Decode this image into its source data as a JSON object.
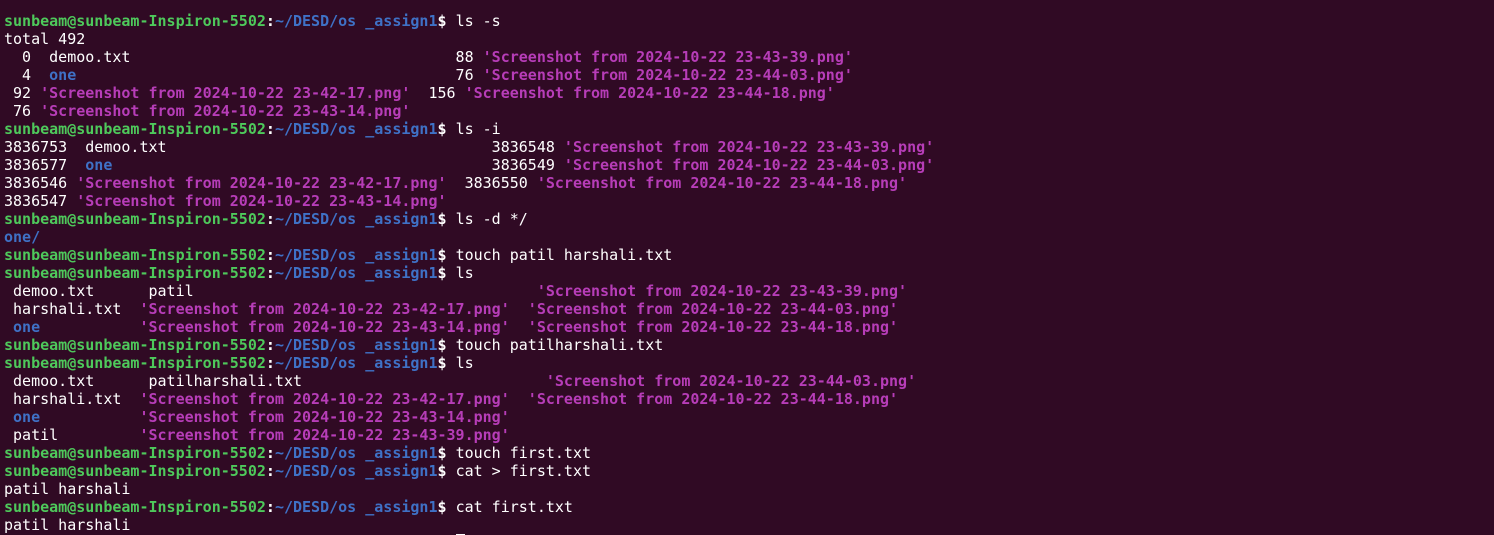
{
  "terminal": {
    "prompt": {
      "user_host": "sunbeam@sunbeam-Inspiron-5502",
      "colon": ":",
      "path": "~/DESD/os _assign1",
      "dollar": "$ "
    },
    "colors": {
      "background": "#300a24",
      "text": "#ffffff",
      "prompt_user": "#4ec95b",
      "prompt_path": "#3f71c6",
      "directory": "#3f71c6",
      "image_file": "#b73db8"
    },
    "lines": [
      {
        "kind": "out",
        "segments": [
          {
            "t": "",
            "c": "plain"
          }
        ]
      },
      {
        "kind": "cmd",
        "command": "ls -s"
      },
      {
        "kind": "out",
        "segments": [
          {
            "t": "total 492",
            "c": "plain"
          }
        ]
      },
      {
        "kind": "out",
        "segments": [
          {
            "t": "  0  demoo.txt                                    88 ",
            "c": "plain"
          },
          {
            "t": "'Screenshot from 2024-10-22 23-43-39.png'",
            "c": "img"
          }
        ]
      },
      {
        "kind": "out",
        "segments": [
          {
            "t": "  4  ",
            "c": "plain"
          },
          {
            "t": "one",
            "c": "dir"
          },
          {
            "t": "                                          76 ",
            "c": "plain"
          },
          {
            "t": "'Screenshot from 2024-10-22 23-44-03.png'",
            "c": "img"
          }
        ]
      },
      {
        "kind": "out",
        "segments": [
          {
            "t": " 92 ",
            "c": "plain"
          },
          {
            "t": "'Screenshot from 2024-10-22 23-42-17.png'",
            "c": "img"
          },
          {
            "t": "  156 ",
            "c": "plain"
          },
          {
            "t": "'Screenshot from 2024-10-22 23-44-18.png'",
            "c": "img"
          }
        ]
      },
      {
        "kind": "out",
        "segments": [
          {
            "t": " 76 ",
            "c": "plain"
          },
          {
            "t": "'Screenshot from 2024-10-22 23-43-14.png'",
            "c": "img"
          }
        ]
      },
      {
        "kind": "cmd",
        "command": "ls -i"
      },
      {
        "kind": "out",
        "segments": [
          {
            "t": "3836753  demoo.txt                                    3836548 ",
            "c": "plain"
          },
          {
            "t": "'Screenshot from 2024-10-22 23-43-39.png'",
            "c": "img"
          }
        ]
      },
      {
        "kind": "out",
        "segments": [
          {
            "t": "3836577  ",
            "c": "plain"
          },
          {
            "t": "one",
            "c": "dir"
          },
          {
            "t": "                                          3836549 ",
            "c": "plain"
          },
          {
            "t": "'Screenshot from 2024-10-22 23-44-03.png'",
            "c": "img"
          }
        ]
      },
      {
        "kind": "out",
        "segments": [
          {
            "t": "3836546 ",
            "c": "plain"
          },
          {
            "t": "'Screenshot from 2024-10-22 23-42-17.png'",
            "c": "img"
          },
          {
            "t": "  3836550 ",
            "c": "plain"
          },
          {
            "t": "'Screenshot from 2024-10-22 23-44-18.png'",
            "c": "img"
          }
        ]
      },
      {
        "kind": "out",
        "segments": [
          {
            "t": "3836547 ",
            "c": "plain"
          },
          {
            "t": "'Screenshot from 2024-10-22 23-43-14.png'",
            "c": "img"
          }
        ]
      },
      {
        "kind": "cmd",
        "command": "ls -d */"
      },
      {
        "kind": "out",
        "segments": [
          {
            "t": "one/",
            "c": "dir"
          }
        ]
      },
      {
        "kind": "cmd",
        "command": "touch patil harshali.txt"
      },
      {
        "kind": "cmd",
        "command": "ls"
      },
      {
        "kind": "out",
        "segments": [
          {
            "t": " demoo.txt      patil                                      ",
            "c": "plain"
          },
          {
            "t": "'Screenshot from 2024-10-22 23-43-39.png'",
            "c": "img"
          }
        ]
      },
      {
        "kind": "out",
        "segments": [
          {
            "t": " harshali.txt  ",
            "c": "plain"
          },
          {
            "t": "'Screenshot from 2024-10-22 23-42-17.png'",
            "c": "img"
          },
          {
            "t": "  ",
            "c": "plain"
          },
          {
            "t": "'Screenshot from 2024-10-22 23-44-03.png'",
            "c": "img"
          }
        ]
      },
      {
        "kind": "out",
        "segments": [
          {
            "t": " ",
            "c": "plain"
          },
          {
            "t": "one",
            "c": "dir"
          },
          {
            "t": "           ",
            "c": "plain"
          },
          {
            "t": "'Screenshot from 2024-10-22 23-43-14.png'",
            "c": "img"
          },
          {
            "t": "  ",
            "c": "plain"
          },
          {
            "t": "'Screenshot from 2024-10-22 23-44-18.png'",
            "c": "img"
          }
        ]
      },
      {
        "kind": "cmd",
        "command": "touch patilharshali.txt"
      },
      {
        "kind": "cmd",
        "command": "ls"
      },
      {
        "kind": "out",
        "segments": [
          {
            "t": " demoo.txt      patilharshali.txt                           ",
            "c": "plain"
          },
          {
            "t": "'Screenshot from 2024-10-22 23-44-03.png'",
            "c": "img"
          }
        ]
      },
      {
        "kind": "out",
        "segments": [
          {
            "t": " harshali.txt  ",
            "c": "plain"
          },
          {
            "t": "'Screenshot from 2024-10-22 23-42-17.png'",
            "c": "img"
          },
          {
            "t": "  ",
            "c": "plain"
          },
          {
            "t": "'Screenshot from 2024-10-22 23-44-18.png'",
            "c": "img"
          }
        ]
      },
      {
        "kind": "out",
        "segments": [
          {
            "t": " ",
            "c": "plain"
          },
          {
            "t": "one",
            "c": "dir"
          },
          {
            "t": "           ",
            "c": "plain"
          },
          {
            "t": "'Screenshot from 2024-10-22 23-43-14.png'",
            "c": "img"
          }
        ]
      },
      {
        "kind": "out",
        "segments": [
          {
            "t": " patil         ",
            "c": "plain"
          },
          {
            "t": "'Screenshot from 2024-10-22 23-43-39.png'",
            "c": "img"
          }
        ]
      },
      {
        "kind": "cmd",
        "command": "touch first.txt"
      },
      {
        "kind": "cmd",
        "command": "cat > first.txt"
      },
      {
        "kind": "out",
        "segments": [
          {
            "t": "patil harshali",
            "c": "plain"
          }
        ]
      },
      {
        "kind": "cmd",
        "command": "cat first.txt"
      },
      {
        "kind": "out",
        "segments": [
          {
            "t": "patil harshali",
            "c": "plain"
          }
        ]
      },
      {
        "kind": "cmd",
        "command": "",
        "cursor": true
      }
    ]
  }
}
